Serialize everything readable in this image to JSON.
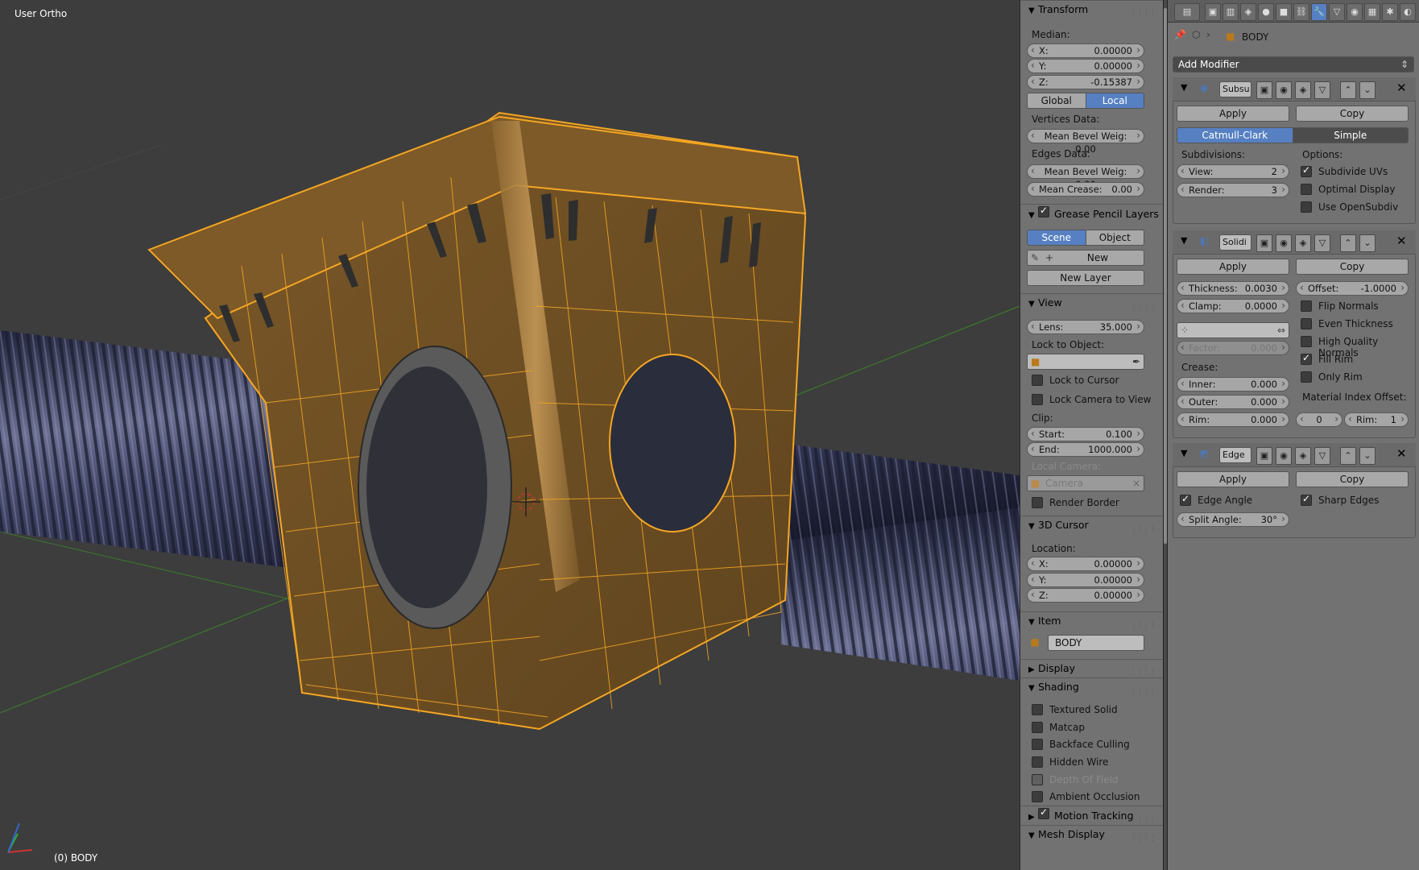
{
  "viewport": {
    "view_name": "User Ortho",
    "object_status": "(0) BODY"
  },
  "npanel": {
    "transform": {
      "header": "Transform",
      "median_label": "Median:",
      "x": {
        "label": "X:",
        "value": "0.00000"
      },
      "y": {
        "label": "Y:",
        "value": "0.00000"
      },
      "z": {
        "label": "Z:",
        "value": "-0.15387"
      },
      "global_label": "Global",
      "local_label": "Local",
      "vertices_data_label": "Vertices Data:",
      "mean_bevel_vert": "Mean Bevel Weig: 0.00",
      "edges_data_label": "Edges Data:",
      "mean_bevel_edge": "Mean Bevel Weig: 0.00",
      "mean_crease": {
        "label": "Mean Crease:",
        "value": "0.00"
      }
    },
    "grease_pencil": {
      "header": "Grease Pencil Layers",
      "scene_label": "Scene",
      "object_label": "Object",
      "new_label": "New",
      "new_layer_label": "New Layer"
    },
    "view": {
      "header": "View",
      "lens": {
        "label": "Lens:",
        "value": "35.000"
      },
      "lock_to_object_label": "Lock to Object:",
      "lock_to_cursor": "Lock to Cursor",
      "lock_camera_to_view": "Lock Camera to View",
      "clip_label": "Clip:",
      "clip_start": {
        "label": "Start:",
        "value": "0.100"
      },
      "clip_end": {
        "label": "End:",
        "value": "1000.000"
      },
      "local_camera_label": "Local Camera:",
      "camera_value": "Camera",
      "render_border": "Render Border"
    },
    "cursor": {
      "header": "3D Cursor",
      "location_label": "Location:",
      "x": {
        "label": "X:",
        "value": "0.00000"
      },
      "y": {
        "label": "Y:",
        "value": "0.00000"
      },
      "z": {
        "label": "Z:",
        "value": "0.00000"
      }
    },
    "item": {
      "header": "Item",
      "name": "BODY"
    },
    "display": {
      "header": "Display"
    },
    "shading": {
      "header": "Shading",
      "textured_solid": "Textured Solid",
      "matcap": "Matcap",
      "backface_culling": "Backface Culling",
      "hidden_wire": "Hidden Wire",
      "depth_of_field": "Depth Of Field",
      "ambient_occlusion": "Ambient Occlusion"
    },
    "motion_tracking": {
      "header": "Motion Tracking"
    },
    "mesh_display": {
      "header": "Mesh Display"
    }
  },
  "properties": {
    "object_name": "BODY",
    "add_modifier_label": "Add Modifier",
    "subsurf": {
      "name": "Subsu",
      "apply_label": "Apply",
      "copy_label": "Copy",
      "catmull_label": "Catmull-Clark",
      "simple_label": "Simple",
      "subdivisions_label": "Subdivisions:",
      "options_label": "Options:",
      "view": {
        "label": "View:",
        "value": "2"
      },
      "render": {
        "label": "Render:",
        "value": "3"
      },
      "subdivide_uvs": "Subdivide UVs",
      "optimal_display": "Optimal Display",
      "use_opensubdiv": "Use OpenSubdiv"
    },
    "solidify": {
      "name": "Solidi",
      "apply_label": "Apply",
      "copy_label": "Copy",
      "thickness": {
        "label": "Thickness:",
        "value": "0.0030"
      },
      "offset": {
        "label": "Offset:",
        "value": "-1.0000"
      },
      "clamp": {
        "label": "Clamp:",
        "value": "0.0000"
      },
      "flip_normals": "Flip Normals",
      "even_thickness": "Even Thickness",
      "high_quality_normals": "High Quality Normals",
      "fill_rim": "Fill Rim",
      "only_rim": "Only Rim",
      "factor": {
        "label": "Factor:",
        "value": "0.000"
      },
      "crease_label": "Crease:",
      "inner": {
        "label": "Inner:",
        "value": "0.000"
      },
      "outer": {
        "label": "Outer:",
        "value": "0.000"
      },
      "rim": {
        "label": "Rim:",
        "value": "0.000"
      },
      "material_index_label": "Material Index Offset:",
      "mat_index": {
        "value": "0"
      },
      "mat_rim": {
        "label": "Rim:",
        "value": "1"
      }
    },
    "edgesplit": {
      "name": "Edge",
      "apply_label": "Apply",
      "copy_label": "Copy",
      "edge_angle": "Edge Angle",
      "sharp_edges": "Sharp Edges",
      "split_angle": {
        "label": "Split Angle:",
        "value": "30°"
      }
    }
  },
  "colors": {
    "selection_orange": "#f5a623",
    "active_blue": "#5680c2",
    "screw_blue": "#3e4262"
  }
}
